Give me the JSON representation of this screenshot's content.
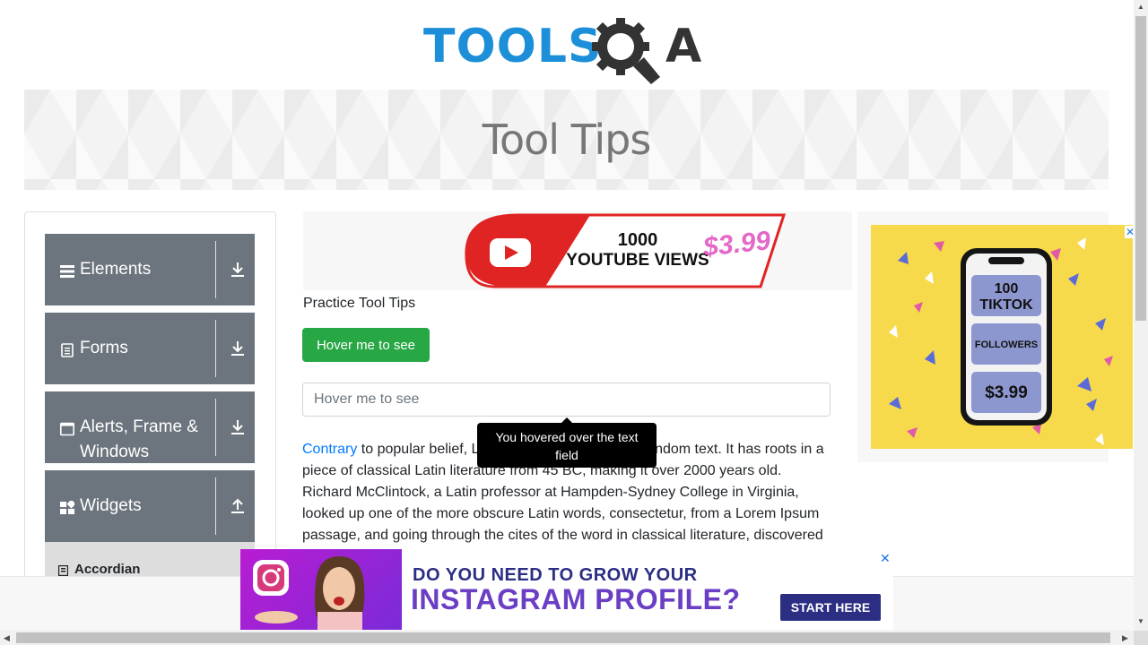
{
  "logo": {
    "left": "TOOLS",
    "right": "A"
  },
  "banner": {
    "title": "Tool Tips"
  },
  "sidebar": {
    "groups": [
      {
        "label": "Elements",
        "icon": "hamburger-icon",
        "toggle": "download-arrow-icon"
      },
      {
        "label": "Forms",
        "icon": "document-icon",
        "toggle": "download-arrow-icon"
      },
      {
        "label": "Alerts, Frame &",
        "label2": "Windows",
        "icon": "window-icon",
        "toggle": "download-arrow-icon"
      },
      {
        "label": "Widgets",
        "icon": "grid-icon",
        "toggle": "upload-arrow-icon"
      }
    ],
    "subitems": [
      {
        "label": "Accordian",
        "icon": "accordian-icon"
      }
    ]
  },
  "ads": {
    "top_text1": "1000",
    "top_text2": "YOUTUBE VIEWS",
    "top_price": "$3.99",
    "right_text1": "100",
    "right_text2": "TIKTOK",
    "right_text3": "FOLLOWERS",
    "right_price": "$3.99",
    "bottom_line1": "DO YOU NEED TO GROW YOUR",
    "bottom_line2": "INSTAGRAM PROFILE?",
    "bottom_cta": "START HERE"
  },
  "main": {
    "section_label": "Practice Tool Tips",
    "button_label": "Hover me to see",
    "input_placeholder": "Hover me to see",
    "link_text": "Contrary",
    "paragraph": " to popular belief, Lorem Ipsum is not simply random text. It has roots in a piece of classical Latin literature from 45 BC, making it over 2000 years old. Richard McClintock, a Latin professor at Hampden-Sydney College in Virginia, looked up one of the more obscure Latin words, consectetur, from a Lorem Ipsum passage, and going through the cites of the word in classical literature, discovered the",
    "tooltip_text": "You hovered over the text field"
  },
  "colors": {
    "accent_blue": "#1d8fd8",
    "button_green": "#28a745",
    "sidebar_gray": "#6c757d"
  }
}
